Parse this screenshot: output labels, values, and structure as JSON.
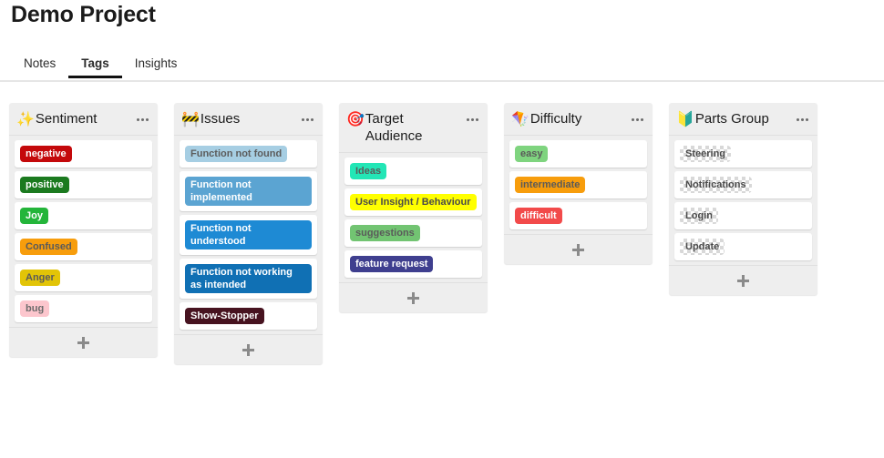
{
  "header": {
    "title": "Demo Project"
  },
  "tabs": [
    {
      "label": "Notes",
      "active": false
    },
    {
      "label": "Tags",
      "active": true
    },
    {
      "label": "Insights",
      "active": false
    }
  ],
  "add_button_label": "+",
  "menu_label": "•••",
  "columns": [
    {
      "title": "Sentiment",
      "icon": "sparkles-emoji",
      "icon_glyph": "✨",
      "tags": [
        {
          "label": "negative",
          "color": "#c4090b",
          "text_color": "#ffffff"
        },
        {
          "label": "positive",
          "color": "#1b7a1f",
          "text_color": "#ffffff"
        },
        {
          "label": "Joy",
          "color": "#24b53a",
          "text_color": "#ffffff"
        },
        {
          "label": "Confused",
          "color": "#f79d0c",
          "text_color": "#5a5a5a"
        },
        {
          "label": "Anger",
          "color": "#e2c407",
          "text_color": "#5a5a5a"
        },
        {
          "label": "bug",
          "color": "#fcc6cd",
          "text_color": "#6b6b6b"
        }
      ]
    },
    {
      "title": "Issues",
      "icon": "construction-barrier-emoji",
      "icon_glyph": "🚧",
      "tags": [
        {
          "label": "Function not found",
          "color": "#a6cee3",
          "text_color": "#5c5c5c"
        },
        {
          "label": "Function not implemented",
          "color": "#5ba4d2",
          "text_color": "#ffffff"
        },
        {
          "label": "Function not understood",
          "color": "#1e8ad4",
          "text_color": "#ffffff"
        },
        {
          "label": "Function not working as intended",
          "color": "#1070b4",
          "text_color": "#ffffff"
        },
        {
          "label": "Show-Stopper",
          "color": "#471320",
          "text_color": "#ffffff"
        }
      ]
    },
    {
      "title": "Target Audience",
      "icon": "dart-target-emoji",
      "icon_glyph": "🎯",
      "tags": [
        {
          "label": "Ideas",
          "color": "#23e6b6",
          "text_color": "#5a5a5a"
        },
        {
          "label": "User Insight / Behaviour",
          "color": "#ffff00",
          "text_color": "#4a4a4a"
        },
        {
          "label": "suggestions",
          "color": "#72c472",
          "text_color": "#5a5a5a"
        },
        {
          "label": "feature request",
          "color": "#3f3f8f",
          "text_color": "#ffffff"
        }
      ]
    },
    {
      "title": "Difficulty",
      "icon": "kite-emoji",
      "icon_glyph": "🪁",
      "tags": [
        {
          "label": "easy",
          "color": "#7fd47f",
          "text_color": "#5a5a5a"
        },
        {
          "label": "intermediate",
          "color": "#f79d0c",
          "text_color": "#5a5a5a"
        },
        {
          "label": "difficult",
          "color": "#f24a4a",
          "text_color": "#ffffff"
        }
      ]
    },
    {
      "title": "Parts Group",
      "icon": "beginner-symbol-emoji",
      "icon_glyph": "🔰",
      "tags": [
        {
          "label": "Steering",
          "color": "transparent",
          "text_color": "#4a4a4a"
        },
        {
          "label": "Notifications",
          "color": "transparent",
          "text_color": "#4a4a4a"
        },
        {
          "label": "Login",
          "color": "transparent",
          "text_color": "#4a4a4a"
        },
        {
          "label": "Update",
          "color": "transparent",
          "text_color": "#4a4a4a"
        }
      ]
    }
  ]
}
